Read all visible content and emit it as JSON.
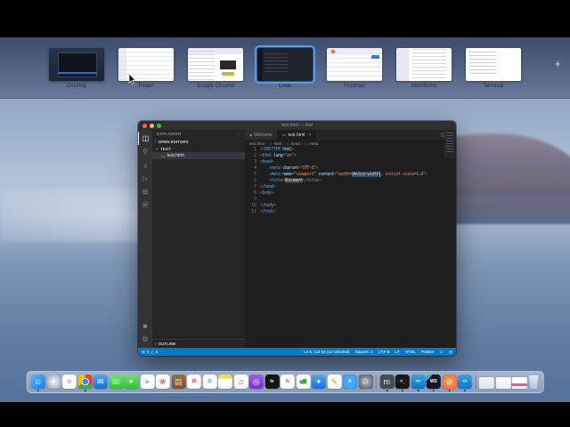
{
  "colors": {
    "statusbar": "#007acc",
    "selection": "#264f78",
    "thumb-accent": "#4f9bf7",
    "dock-dot": "#2b2b2b"
  },
  "app_switcher": {
    "thumbnails": [
      {
        "label": "Desktop",
        "kind": "desktop"
      },
      {
        "label": "Finder",
        "kind": "finder"
      },
      {
        "label": "Google Chrome",
        "kind": "chrome"
      },
      {
        "label": "Code",
        "kind": "code",
        "selected": true
      },
      {
        "label": "Postman",
        "kind": "postman"
      },
      {
        "label": "WebStorm",
        "kind": "webstorm"
      },
      {
        "label": "Terminal",
        "kind": "terminal"
      }
    ],
    "add_button": "+"
  },
  "vscode": {
    "window_title": "test.html — test",
    "activity_bar": {
      "top": [
        {
          "name": "explorer",
          "glyph": "◫",
          "active": true
        },
        {
          "name": "search",
          "glyph": "⚲"
        },
        {
          "name": "source-control",
          "glyph": "Y"
        },
        {
          "name": "run-debug",
          "glyph": "▷"
        },
        {
          "name": "extensions",
          "glyph": "⊞"
        },
        {
          "name": "wordpress",
          "glyph": "Ⓦ"
        }
      ],
      "bottom": [
        {
          "name": "accounts",
          "glyph": "☻"
        },
        {
          "name": "settings",
          "glyph": "⚙"
        }
      ]
    },
    "explorer": {
      "title": "EXPLORER",
      "more": "···",
      "open_editors": "OPEN EDITORS",
      "folder": "TEST",
      "file": "test.html",
      "file_icon": "<>",
      "outline": "OUTLINE",
      "chevron_collapsed": "›",
      "chevron_expanded": "⌄"
    },
    "tabs": [
      {
        "label": "Welcome",
        "icon": "◆"
      },
      {
        "label": "test.html",
        "icon": "<>",
        "close": "×",
        "active": true
      }
    ],
    "tab_actions": {
      "split": "◫",
      "more": "···"
    },
    "breadcrumb": [
      {
        "label": "test.html",
        "icon": ""
      },
      {
        "label": "html",
        "icon": "◇"
      },
      {
        "label": "head",
        "icon": "◇"
      },
      {
        "label": "meta",
        "icon": "◇"
      }
    ],
    "code_lines": [
      [
        {
          "t": "<!",
          "c": "p"
        },
        {
          "t": "DOCTYPE",
          "c": "t"
        },
        {
          "t": " html",
          "c": "a"
        },
        {
          "t": ">",
          "c": "p"
        }
      ],
      [
        {
          "t": "<",
          "c": "p"
        },
        {
          "t": "html",
          "c": "t"
        },
        {
          "t": " lang",
          "c": "a"
        },
        {
          "t": "=",
          "c": "p"
        },
        {
          "t": "\"en\"",
          "c": "v"
        },
        {
          "t": ">",
          "c": "p"
        }
      ],
      [
        {
          "t": "<",
          "c": "p"
        },
        {
          "t": "head",
          "c": "t"
        },
        {
          "t": ">",
          "c": "p"
        }
      ],
      [
        {
          "t": "    <",
          "c": "p"
        },
        {
          "t": "meta",
          "c": "t"
        },
        {
          "t": " charset",
          "c": "a"
        },
        {
          "t": "=",
          "c": "p"
        },
        {
          "t": "\"UTF-8\"",
          "c": "v"
        },
        {
          "t": ">",
          "c": "p"
        }
      ],
      [
        {
          "t": "    <",
          "c": "p"
        },
        {
          "t": "meta",
          "c": "t"
        },
        {
          "t": " name",
          "c": "a"
        },
        {
          "t": "=",
          "c": "p"
        },
        {
          "t": "\"viewport\"",
          "c": "v"
        },
        {
          "t": " content",
          "c": "a"
        },
        {
          "t": "=",
          "c": "p"
        },
        {
          "t": "\"width=",
          "c": "v"
        },
        {
          "t": "device-width",
          "c": "v sel"
        },
        {
          "t": "",
          "c": "caret"
        },
        {
          "t": ", initial-scale=1.0\"",
          "c": "v"
        },
        {
          "t": ">",
          "c": "p"
        }
      ],
      [
        {
          "t": "    <",
          "c": "p"
        },
        {
          "t": "title",
          "c": "t"
        },
        {
          "t": ">",
          "c": "p"
        },
        {
          "t": "Document",
          "c": "x hl"
        },
        {
          "t": "</",
          "c": "p"
        },
        {
          "t": "title",
          "c": "t"
        },
        {
          "t": ">",
          "c": "p"
        }
      ],
      [
        {
          "t": "</",
          "c": "p"
        },
        {
          "t": "head",
          "c": "t"
        },
        {
          "t": ">",
          "c": "p"
        }
      ],
      [
        {
          "t": "<",
          "c": "p"
        },
        {
          "t": "body",
          "c": "t"
        },
        {
          "t": ">",
          "c": "p"
        }
      ],
      [
        {
          "t": "    ",
          "c": "x"
        }
      ],
      [
        {
          "t": "</",
          "c": "p"
        },
        {
          "t": "body",
          "c": "t"
        },
        {
          "t": ">",
          "c": "p"
        }
      ],
      [
        {
          "t": "</",
          "c": "p"
        },
        {
          "t": "html",
          "c": "t"
        },
        {
          "t": ">",
          "c": "p"
        }
      ]
    ],
    "status_bar": {
      "left": [
        {
          "name": "errors",
          "glyph": "⊘",
          "count": "0"
        },
        {
          "name": "warnings",
          "glyph": "△",
          "count": "0"
        }
      ],
      "right": [
        "Ln 5, Col 54 (12 selected)",
        "Spaces: 4",
        "UTF-8",
        "LF",
        "HTML",
        "Prettier"
      ],
      "right_icons": [
        {
          "name": "feedback",
          "glyph": "☺"
        },
        {
          "name": "notifications",
          "glyph": "◎"
        }
      ]
    }
  },
  "dock": {
    "items": [
      {
        "name": "finder",
        "glyph": "☺",
        "bg": "linear-gradient(135deg,#56b4f5,#1e7de0)",
        "fg": "#ffffff",
        "dot": true
      },
      {
        "name": "launchpad",
        "glyph": "✦",
        "bg": "radial-gradient(circle,#d7dde8 30%,#8d97ab)",
        "fg": "#ffffff"
      },
      {
        "name": "safari",
        "glyph": "✧",
        "bg": "radial-gradient(circle,#ffffff 55%,#e6e9ee)",
        "fg": "#2a7cf7"
      },
      {
        "name": "chrome",
        "glyph": "",
        "bg": "radial-gradient(circle at 50% 50%,#4286f5 0 28%,#ffffff 30% 36%,rgba(0,0,0,0) 37%),conic-gradient(#ea4335 0 33%,#34a853 33% 66%,#fbbc05 66% 100%)",
        "dot": true
      },
      {
        "name": "mail",
        "glyph": "✉",
        "bg": "linear-gradient(#4aa9f5,#1d6fd2)",
        "fg": "#ffffff"
      },
      {
        "name": "messages",
        "glyph": "☏",
        "bg": "linear-gradient(#72e070,#34c234)",
        "fg": "#ffffff"
      },
      {
        "name": "facetime",
        "glyph": "▶",
        "bg": "linear-gradient(#72e070,#34c234)",
        "fg": "#ffffff",
        "small": true
      },
      {
        "name": "maps",
        "glyph": "➢",
        "bg": "#ffffff",
        "fg": "#34a853"
      },
      {
        "name": "photos",
        "glyph": "❀",
        "bg": "#ffffff",
        "fg": "#e8566c"
      },
      {
        "name": "contacts",
        "glyph": "▤",
        "bg": "linear-gradient(#9a6a44,#7d5233)",
        "fg": "#e8d9c8"
      },
      {
        "name": "calendar",
        "glyph": "15",
        "bg": "#ffffff",
        "fg": "#e03131",
        "small": true
      },
      {
        "name": "reminders",
        "glyph": "☰",
        "bg": "#ffffff",
        "fg": "#5a8df0",
        "small": true
      },
      {
        "name": "notes",
        "glyph": "",
        "bg": "linear-gradient(#f8d64e 0 28%,#fdfdf8 28%)"
      },
      {
        "name": "music",
        "glyph": "♫",
        "bg": "#ffffff",
        "fg": "#fa2d48"
      },
      {
        "name": "podcasts",
        "glyph": "◎",
        "bg": "linear-gradient(#a05cf0,#7a2fd0)",
        "fg": "#ffffff"
      },
      {
        "name": "tv",
        "glyph": "tv",
        "bg": "#141414",
        "fg": "#ffffff",
        "small": true
      },
      {
        "name": "news",
        "glyph": "N",
        "bg": "#ffffff",
        "fg": "#fa3d5f",
        "small": true
      },
      {
        "name": "numbers",
        "glyph": "▅▇",
        "bg": "#ffffff",
        "fg": "#34a853",
        "small": true
      },
      {
        "name": "keynote",
        "glyph": "✦",
        "bg": "linear-gradient(#4aa9f5,#1d6fd2)",
        "fg": "#ffffff"
      },
      {
        "name": "pages",
        "glyph": "✎",
        "bg": "#ffffff",
        "fg": "#e8862f"
      },
      {
        "name": "appstore",
        "glyph": "A",
        "bg": "radial-gradient(circle,#44a8f5 60%,#1d7fe0)",
        "fg": "#ffffff",
        "small": true
      },
      {
        "name": "system-preferences",
        "glyph": "⚙",
        "bg": "radial-gradient(circle,#8f959e 40%,#4a4f57)",
        "fg": "#dddddd"
      },
      {
        "sep": true
      },
      {
        "name": "mamp",
        "glyph": "m",
        "bg": "#454b57",
        "fg": "#f2f2f2",
        "dot": true
      },
      {
        "name": "terminal",
        "glyph": ">_",
        "bg": "#181818",
        "fg": "#ffffff",
        "small": true,
        "dot": true
      },
      {
        "name": "vscode",
        "glyph": "<>",
        "bg": "linear-gradient(#35a4e8,#1272c4)",
        "fg": "#ffffff",
        "small": true,
        "dot": true
      },
      {
        "name": "webstorm",
        "glyph": "WS",
        "bg": "linear-gradient(135deg,#00cdd7 0 22%,#14142a 22%)",
        "fg": "#ffffff",
        "small": true,
        "dot": true
      },
      {
        "name": "postman",
        "glyph": "⊘",
        "bg": "radial-gradient(circle,#ff8c4f 40%,#f05c1d)",
        "fg": "#ffffff",
        "dot": true
      },
      {
        "name": "vscode-insiders",
        "glyph": "<>",
        "bg": "linear-gradient(#35a4e8,#1272c4)",
        "fg": "#ffffff",
        "small": true,
        "dot": true
      },
      {
        "sep": true
      },
      {
        "name": "minimized-window-1",
        "glyph": "",
        "bg": "linear-gradient(#f4f6f8,#dde2e8)",
        "win": true
      },
      {
        "name": "minimized-window-2",
        "glyph": "",
        "bg": "linear-gradient(#ffffff,#e8ecf0)",
        "win": true
      },
      {
        "name": "minimized-window-3",
        "glyph": "",
        "bg": "linear-gradient(#ffffff 55%,#e05ca8 55% 75%,#f0f0f0 75%)",
        "win": true
      },
      {
        "name": "trash",
        "glyph": "",
        "bg": "linear-gradient(rgba(255,255,255,.7),rgba(255,255,255,.35))",
        "trash": true
      }
    ]
  }
}
